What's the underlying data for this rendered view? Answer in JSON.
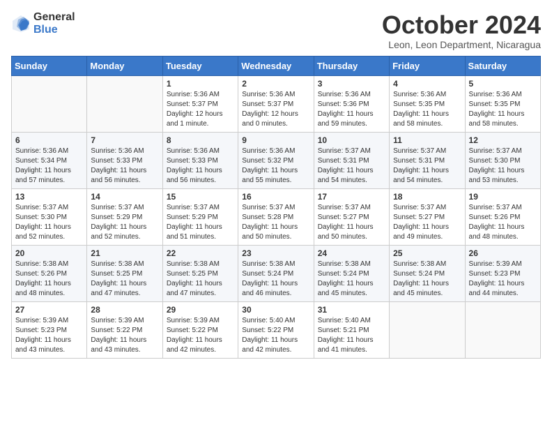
{
  "header": {
    "logo_general": "General",
    "logo_blue": "Blue",
    "month_title": "October 2024",
    "location": "Leon, Leon Department, Nicaragua"
  },
  "calendar": {
    "days_of_week": [
      "Sunday",
      "Monday",
      "Tuesday",
      "Wednesday",
      "Thursday",
      "Friday",
      "Saturday"
    ],
    "weeks": [
      [
        {
          "day": "",
          "info": ""
        },
        {
          "day": "",
          "info": ""
        },
        {
          "day": "1",
          "info": "Sunrise: 5:36 AM\nSunset: 5:37 PM\nDaylight: 12 hours\nand 1 minute."
        },
        {
          "day": "2",
          "info": "Sunrise: 5:36 AM\nSunset: 5:37 PM\nDaylight: 12 hours\nand 0 minutes."
        },
        {
          "day": "3",
          "info": "Sunrise: 5:36 AM\nSunset: 5:36 PM\nDaylight: 11 hours\nand 59 minutes."
        },
        {
          "day": "4",
          "info": "Sunrise: 5:36 AM\nSunset: 5:35 PM\nDaylight: 11 hours\nand 58 minutes."
        },
        {
          "day": "5",
          "info": "Sunrise: 5:36 AM\nSunset: 5:35 PM\nDaylight: 11 hours\nand 58 minutes."
        }
      ],
      [
        {
          "day": "6",
          "info": "Sunrise: 5:36 AM\nSunset: 5:34 PM\nDaylight: 11 hours\nand 57 minutes."
        },
        {
          "day": "7",
          "info": "Sunrise: 5:36 AM\nSunset: 5:33 PM\nDaylight: 11 hours\nand 56 minutes."
        },
        {
          "day": "8",
          "info": "Sunrise: 5:36 AM\nSunset: 5:33 PM\nDaylight: 11 hours\nand 56 minutes."
        },
        {
          "day": "9",
          "info": "Sunrise: 5:36 AM\nSunset: 5:32 PM\nDaylight: 11 hours\nand 55 minutes."
        },
        {
          "day": "10",
          "info": "Sunrise: 5:37 AM\nSunset: 5:31 PM\nDaylight: 11 hours\nand 54 minutes."
        },
        {
          "day": "11",
          "info": "Sunrise: 5:37 AM\nSunset: 5:31 PM\nDaylight: 11 hours\nand 54 minutes."
        },
        {
          "day": "12",
          "info": "Sunrise: 5:37 AM\nSunset: 5:30 PM\nDaylight: 11 hours\nand 53 minutes."
        }
      ],
      [
        {
          "day": "13",
          "info": "Sunrise: 5:37 AM\nSunset: 5:30 PM\nDaylight: 11 hours\nand 52 minutes."
        },
        {
          "day": "14",
          "info": "Sunrise: 5:37 AM\nSunset: 5:29 PM\nDaylight: 11 hours\nand 52 minutes."
        },
        {
          "day": "15",
          "info": "Sunrise: 5:37 AM\nSunset: 5:29 PM\nDaylight: 11 hours\nand 51 minutes."
        },
        {
          "day": "16",
          "info": "Sunrise: 5:37 AM\nSunset: 5:28 PM\nDaylight: 11 hours\nand 50 minutes."
        },
        {
          "day": "17",
          "info": "Sunrise: 5:37 AM\nSunset: 5:27 PM\nDaylight: 11 hours\nand 50 minutes."
        },
        {
          "day": "18",
          "info": "Sunrise: 5:37 AM\nSunset: 5:27 PM\nDaylight: 11 hours\nand 49 minutes."
        },
        {
          "day": "19",
          "info": "Sunrise: 5:37 AM\nSunset: 5:26 PM\nDaylight: 11 hours\nand 48 minutes."
        }
      ],
      [
        {
          "day": "20",
          "info": "Sunrise: 5:38 AM\nSunset: 5:26 PM\nDaylight: 11 hours\nand 48 minutes."
        },
        {
          "day": "21",
          "info": "Sunrise: 5:38 AM\nSunset: 5:25 PM\nDaylight: 11 hours\nand 47 minutes."
        },
        {
          "day": "22",
          "info": "Sunrise: 5:38 AM\nSunset: 5:25 PM\nDaylight: 11 hours\nand 47 minutes."
        },
        {
          "day": "23",
          "info": "Sunrise: 5:38 AM\nSunset: 5:24 PM\nDaylight: 11 hours\nand 46 minutes."
        },
        {
          "day": "24",
          "info": "Sunrise: 5:38 AM\nSunset: 5:24 PM\nDaylight: 11 hours\nand 45 minutes."
        },
        {
          "day": "25",
          "info": "Sunrise: 5:38 AM\nSunset: 5:24 PM\nDaylight: 11 hours\nand 45 minutes."
        },
        {
          "day": "26",
          "info": "Sunrise: 5:39 AM\nSunset: 5:23 PM\nDaylight: 11 hours\nand 44 minutes."
        }
      ],
      [
        {
          "day": "27",
          "info": "Sunrise: 5:39 AM\nSunset: 5:23 PM\nDaylight: 11 hours\nand 43 minutes."
        },
        {
          "day": "28",
          "info": "Sunrise: 5:39 AM\nSunset: 5:22 PM\nDaylight: 11 hours\nand 43 minutes."
        },
        {
          "day": "29",
          "info": "Sunrise: 5:39 AM\nSunset: 5:22 PM\nDaylight: 11 hours\nand 42 minutes."
        },
        {
          "day": "30",
          "info": "Sunrise: 5:40 AM\nSunset: 5:22 PM\nDaylight: 11 hours\nand 42 minutes."
        },
        {
          "day": "31",
          "info": "Sunrise: 5:40 AM\nSunset: 5:21 PM\nDaylight: 11 hours\nand 41 minutes."
        },
        {
          "day": "",
          "info": ""
        },
        {
          "day": "",
          "info": ""
        }
      ]
    ]
  }
}
